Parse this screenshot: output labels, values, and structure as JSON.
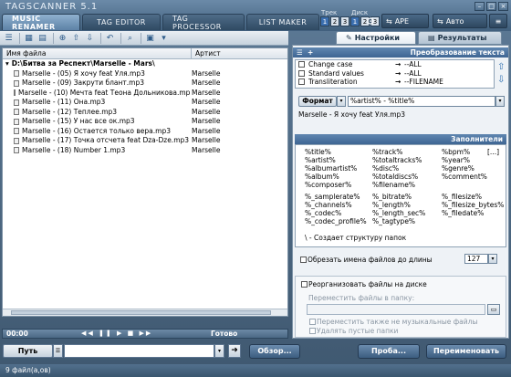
{
  "app": {
    "logo": "TAGSCANNER 5.1"
  },
  "tabs": [
    {
      "label": "MUSIC RENAMER"
    },
    {
      "label": "TAG EDITOR"
    },
    {
      "label": "TAG PROCESSOR"
    },
    {
      "label": "LIST MAKER"
    }
  ],
  "header": {
    "track_label": "Трек",
    "track_values": [
      "1",
      "2",
      "3"
    ],
    "disc_label": "Диск",
    "disc_values": [
      "1",
      "2",
      "3"
    ],
    "ape_label": "APE",
    "auto_label": "Авто",
    "win_min": "–",
    "win_max": "□",
    "win_close": "×"
  },
  "file_list": {
    "col_name": "Имя файла",
    "col_artist": "Артист",
    "folder": "D:\\Битва за Респект\\Marselle - Mars\\",
    "rows": [
      {
        "name": "Marselle - (05) Я хочу feat Уля.mp3",
        "artist": "Marselle"
      },
      {
        "name": "Marselle - (09) Закрути блант.mp3",
        "artist": "Marselle"
      },
      {
        "name": "Marselle - (10) Мечта feat Теона Дольникова.mp3",
        "artist": "Marselle"
      },
      {
        "name": "Marselle - (11) Она.mp3",
        "artist": "Marselle"
      },
      {
        "name": "Marselle - (12) Теплее.mp3",
        "artist": "Marselle"
      },
      {
        "name": "Marselle - (15) У нас все ок.mp3",
        "artist": "Marselle"
      },
      {
        "name": "Marselle - (16) Остается только вера.mp3",
        "artist": "Marselle"
      },
      {
        "name": "Marselle - (17) Точка отсчета feat Dza-Dze.mp3",
        "artist": "Marselle"
      },
      {
        "name": "Marselle - (18) Number 1.mp3",
        "artist": "Marselle"
      }
    ]
  },
  "right_panel": {
    "tab_settings": "Настройки",
    "tab_results": "Результаты",
    "text_transform_header": "Преобразование текста",
    "transforms": [
      {
        "name": "Change case",
        "value": "--ALL"
      },
      {
        "name": "Standard values",
        "value": "--ALL"
      },
      {
        "name": "Transliteration",
        "value": "--FILENAME"
      }
    ],
    "format_button": "Формат",
    "format_value": "%artist% - %title%",
    "preview": "Marselle - Я хочу feat Уля.mp3",
    "placeholders_header": "Заполнители",
    "placeholders_col1": [
      "%title%",
      "%artist%",
      "%albumartist%",
      "%album%",
      "%composer%"
    ],
    "placeholders_col2": [
      "%track%",
      "%totaltracks%",
      "%disc%",
      "%totaldiscs%",
      "%filename%"
    ],
    "placeholders_col3": [
      "%bpm%",
      "%year%",
      "%genre%",
      "%comment%"
    ],
    "more": "[...]",
    "placeholders2_col1": [
      "%_samplerate%",
      "%_channels%",
      "%_codec%",
      "%_codec_profile%"
    ],
    "placeholders2_col2": [
      "%_bitrate%",
      "%_length%",
      "%_length_sec%",
      "%_tagtype%"
    ],
    "placeholders2_col3": [
      "%_filesize%",
      "%_filesize_bytes%",
      "%_filedate%"
    ],
    "folder_hint": "\\ - Создает структуру папок",
    "trim_label": "Обрезать имена файлов до длины",
    "trim_value": "127",
    "reorganize_label": "Реорганизовать файлы на диске",
    "move_to_label": "Переместить файлы в папку:",
    "move_nonmusic_label": "Переместить также не музыкальные файлы",
    "delete_empty_label": "Удалять пустые папки"
  },
  "player": {
    "time": "00:00",
    "status": "Готово"
  },
  "bottom": {
    "path_button": "Путь",
    "browse_button": "Обзор...",
    "preview_button": "Проба...",
    "rename_button": "Переименовать",
    "status_text": "9 файл(а,ов)"
  }
}
